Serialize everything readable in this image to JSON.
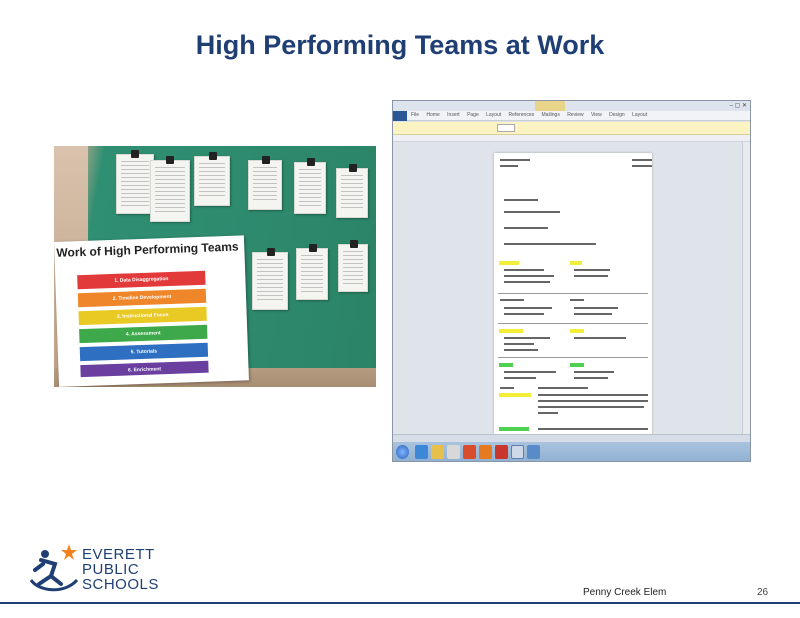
{
  "slide": {
    "title": "High Performing Teams at Work",
    "school": "Penny Creek Elem",
    "page_number": "26"
  },
  "logo": {
    "line1": "EVERETT",
    "line2": "PUBLIC",
    "line3": "SCHOOLS",
    "star_color": "#f58220",
    "brand_color": "#1f3f74"
  },
  "photo": {
    "poster_title": "Work of High Performing Teams",
    "bands": [
      {
        "label": "1. Data Disaggregation",
        "color": "#e23a3a"
      },
      {
        "label": "2. Timeline Development",
        "color": "#f0862a"
      },
      {
        "label": "3. Instructional Focus",
        "color": "#e9c924"
      },
      {
        "label": "4. Assessment",
        "color": "#3da94a"
      },
      {
        "label": "5. Tutorials",
        "color": "#2e6fc2"
      },
      {
        "label": "6. Enrichment",
        "color": "#6a3fa0"
      }
    ]
  },
  "screen": {
    "ribbon_tabs": "File Home Insert Page Layout References Mailings Review View Design Layout"
  }
}
